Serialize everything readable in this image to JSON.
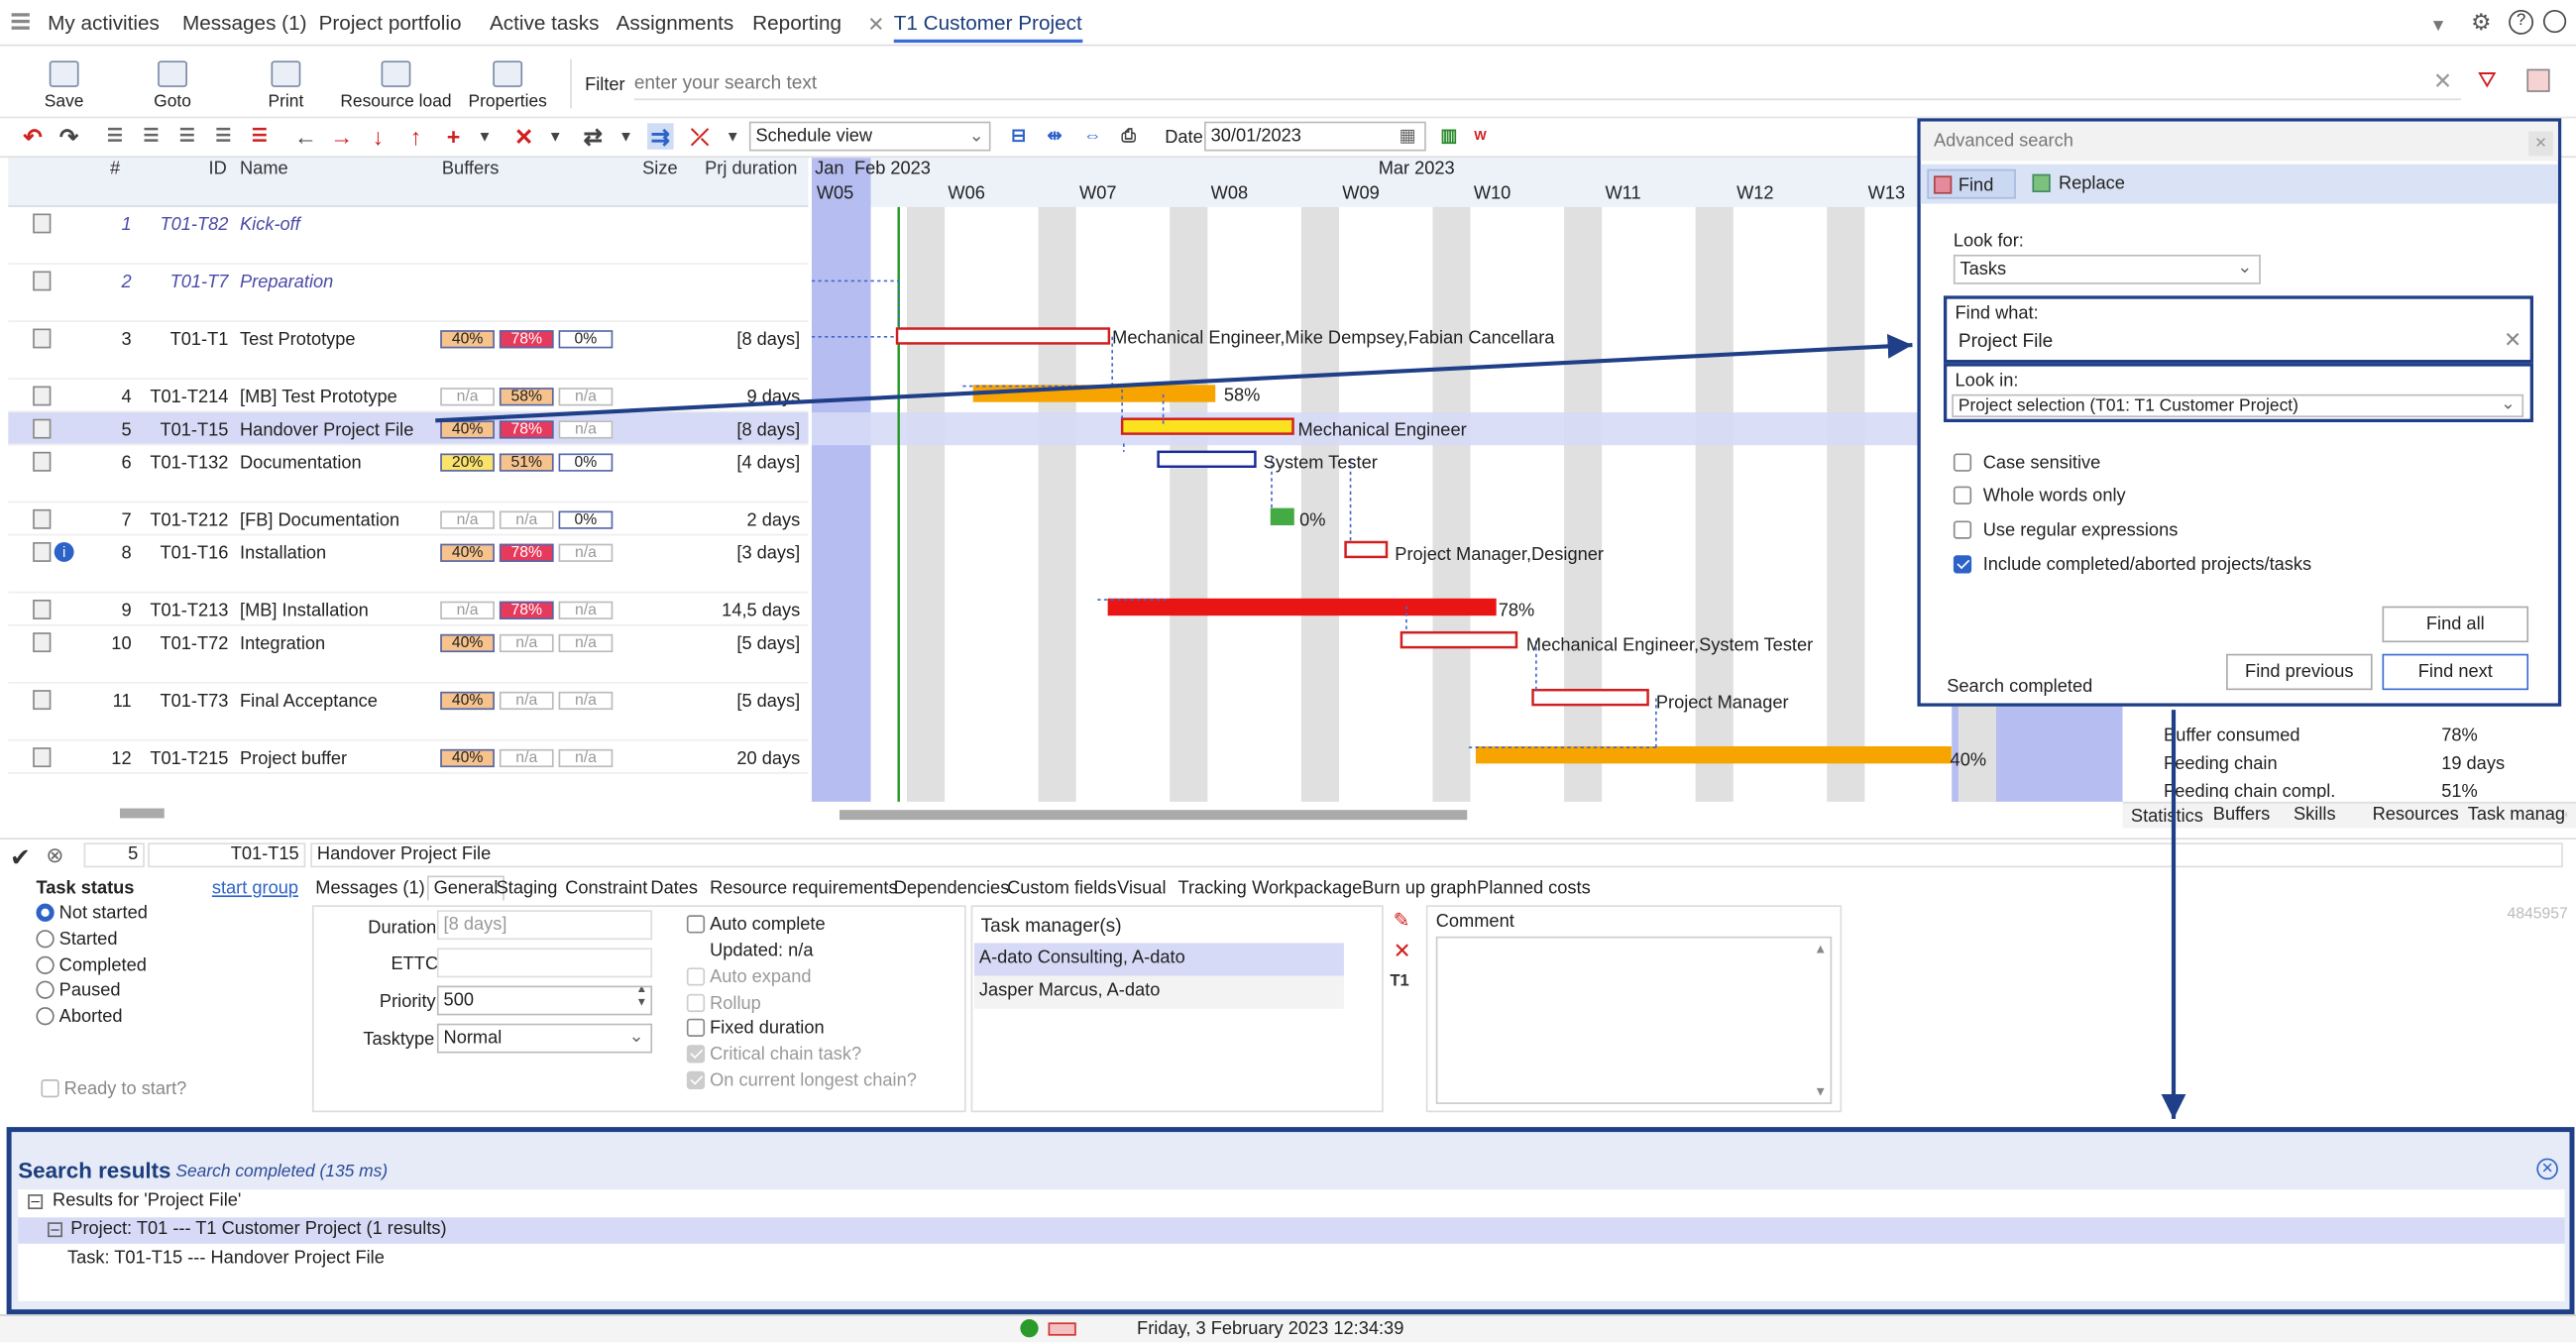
{
  "nav": {
    "tabs": [
      "My activities",
      "Messages (1)",
      "Project portfolio",
      "Active tasks",
      "Assignments",
      "Reporting",
      "T1 Customer Project"
    ]
  },
  "ribbon": {
    "save": "Save",
    "goto": "Goto",
    "print": "Print",
    "resource_load": "Resource load",
    "properties": "Properties",
    "filter_label": "Filter",
    "filter_placeholder": "enter your search text"
  },
  "toolbar": {
    "view": "Schedule view",
    "date_label": "Date",
    "date": "30/01/2023"
  },
  "grid": {
    "headers": {
      "num": "#",
      "id": "ID",
      "name": "Name",
      "buffers": "Buffers",
      "size": "Size",
      "duration": "Prj duration"
    },
    "rows": [
      {
        "num": "1",
        "id": "T01-T82",
        "name": "Kick-off",
        "b": [
          "",
          "",
          ""
        ],
        "size": "",
        "dur": ""
      },
      {
        "num": "2",
        "id": "T01-T7",
        "name": "Preparation",
        "b": [
          "",
          "",
          ""
        ],
        "size": "",
        "dur": ""
      },
      {
        "num": "3",
        "id": "T01-T1",
        "name": "Test Prototype",
        "b": [
          "40%",
          "78%",
          "0%"
        ],
        "size": "",
        "dur": "[8 days]"
      },
      {
        "num": "4",
        "id": "T01-T214",
        "name": "[MB]  Test Prototype",
        "b": [
          "n/a",
          "58%",
          "n/a"
        ],
        "size": "",
        "dur": "9 days"
      },
      {
        "num": "5",
        "id": "T01-T15",
        "name": "Handover Project File",
        "b": [
          "40%",
          "78%",
          "n/a"
        ],
        "size": "",
        "dur": "[8 days]"
      },
      {
        "num": "6",
        "id": "T01-T132",
        "name": "Documentation",
        "b": [
          "20%",
          "51%",
          "0%"
        ],
        "size": "",
        "dur": "[4 days]"
      },
      {
        "num": "7",
        "id": "T01-T212",
        "name": "[FB]  Documentation",
        "b": [
          "n/a",
          "n/a",
          "0%"
        ],
        "size": "",
        "dur": "2 days"
      },
      {
        "num": "8",
        "id": "T01-T16",
        "name": "Installation",
        "b": [
          "40%",
          "78%",
          "n/a"
        ],
        "size": "",
        "dur": "[3 days]"
      },
      {
        "num": "9",
        "id": "T01-T213",
        "name": "[MB]  Installation",
        "b": [
          "n/a",
          "78%",
          "n/a"
        ],
        "size": "",
        "dur": "14,5 days"
      },
      {
        "num": "10",
        "id": "T01-T72",
        "name": "Integration",
        "b": [
          "40%",
          "n/a",
          "n/a"
        ],
        "size": "",
        "dur": "[5 days]"
      },
      {
        "num": "11",
        "id": "T01-T73",
        "name": "Final Acceptance",
        "b": [
          "40%",
          "n/a",
          "n/a"
        ],
        "size": "",
        "dur": "[5 days]"
      },
      {
        "num": "12",
        "id": "T01-T215",
        "name": "Project buffer",
        "b": [
          "40%",
          "n/a",
          "n/a"
        ],
        "size": "",
        "dur": "20 days"
      }
    ]
  },
  "gantt": {
    "months": [
      "Jan",
      "Feb 2023",
      "Mar 2023"
    ],
    "weeks": [
      "W05",
      "W06",
      "W07",
      "W08",
      "W09",
      "W10",
      "W11",
      "W12",
      "W13"
    ],
    "labels": [
      "Mechanical Engineer,Mike Dempsey,Fabian Cancellara",
      "58%",
      "Mechanical Engineer",
      "System Tester",
      "0%",
      "Project Manager,Designer",
      "78%",
      "Mechanical Engineer,System Tester",
      "Project Manager",
      "40%"
    ]
  },
  "adv": {
    "title": "Advanced search",
    "find_tab": "Find",
    "replace_tab": "Replace",
    "look_for_label": "Look for:",
    "look_for": "Tasks",
    "find_what_label": "Find what:",
    "find_what": "Project File",
    "look_in_label": "Look in:",
    "look_in": "Project selection (T01: T1 Customer Project)",
    "opts": [
      "Case sensitive",
      "Whole words only",
      "Use regular expressions",
      "Include completed/aborted projects/tasks"
    ],
    "find_all": "Find all",
    "find_prev": "Find previous",
    "find_next": "Find next",
    "status": "Search completed"
  },
  "stats": {
    "rows": [
      [
        "Buffer consumed",
        "78%"
      ],
      [
        "Feeding chain",
        "19 days"
      ],
      [
        "Feeding chain compl.",
        "51%"
      ]
    ],
    "tabs": [
      "Statistics",
      "Buffers",
      "Skills",
      "Resources",
      "Task manage"
    ]
  },
  "detail": {
    "num": "5",
    "id": "T01-T15",
    "name": "Handover Project File",
    "task_status": "Task status",
    "start_group": "start group",
    "statuses": [
      "Not started",
      "Started",
      "Completed",
      "Paused",
      "Aborted"
    ],
    "ready": "Ready to start?",
    "tabs": [
      "Messages (1)",
      "General",
      "Staging",
      "Constraint",
      "Dates",
      "Resource requirements",
      "Dependencies",
      "Custom fields",
      "Visual",
      "Tracking",
      "Workpackage",
      "Burn up graph",
      "Planned costs"
    ],
    "duration_label": "Duration",
    "duration": "[8 days]",
    "ettc_label": "ETTC",
    "priority_label": "Priority",
    "priority": "500",
    "tasktype_label": "Tasktype",
    "tasktype": "Normal",
    "auto_complete": "Auto complete",
    "updated": "Updated: n/a",
    "auto_expand": "Auto expand",
    "rollup": "Rollup",
    "fixed_duration": "Fixed duration",
    "critical": "Critical chain task?",
    "longest": "On current longest chain?",
    "managers_label": "Task manager(s)",
    "managers": [
      "A-dato Consulting, A-dato",
      "Jasper Marcus, A-dato"
    ],
    "comment_label": "Comment",
    "ref": "4845957"
  },
  "results": {
    "title": "Search results",
    "status": "Search completed (135 ms)",
    "for": "Results for 'Project File'",
    "project": "Project: T01 --- T1 Customer Project (1 results)",
    "task": "Task: T01-T15 --- Handover Project File"
  },
  "statusbar": {
    "datetime": "Friday, 3 February 2023 12:34:39"
  }
}
